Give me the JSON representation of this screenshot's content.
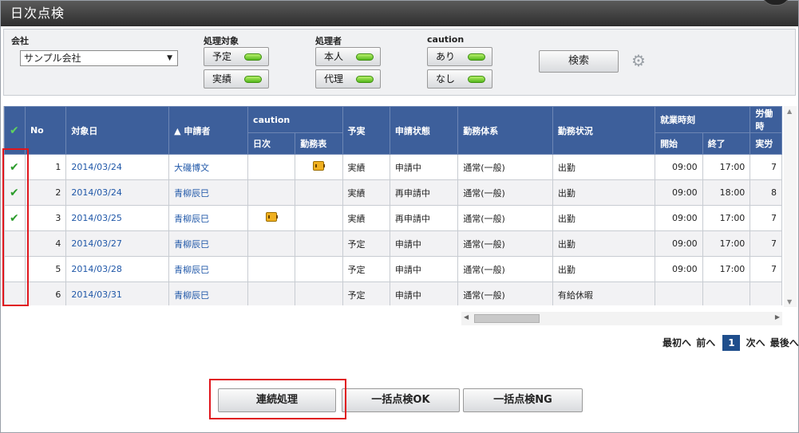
{
  "title": "日次点検",
  "filters": {
    "company_label": "会社",
    "company_value": "サンプル会社",
    "target_label": "処理対象",
    "target_buttons": [
      "予定",
      "実績"
    ],
    "processor_label": "処理者",
    "processor_buttons": [
      "本人",
      "代理"
    ],
    "caution_label": "caution",
    "caution_buttons": [
      "あり",
      "なし"
    ],
    "search_label": "検索"
  },
  "table": {
    "headers": {
      "no": "No",
      "date": "対象日",
      "applicant": "▲ 申請者",
      "caution": "caution",
      "caution_daily": "日次",
      "caution_sheet": "勤務表",
      "plan_actual": "予実",
      "status": "申請状態",
      "system": "勤務体系",
      "work_status": "勤務状況",
      "work_time": "就業時刻",
      "start": "開始",
      "end": "終了",
      "labor": "労働時",
      "labor_sub": "実労"
    },
    "rows": [
      {
        "check": "✔",
        "no": "1",
        "date": "2014/03/24",
        "applicant": "大磯博文",
        "daily": "",
        "sheet": "icon",
        "pa": "実績",
        "status": "申請中",
        "system": "通常(一般)",
        "work": "出勤",
        "start": "09:00",
        "end": "17:00",
        "labor": "7"
      },
      {
        "check": "✔",
        "no": "2",
        "date": "2014/03/24",
        "applicant": "青柳辰巳",
        "daily": "",
        "sheet": "",
        "pa": "実績",
        "status": "再申請中",
        "system": "通常(一般)",
        "work": "出勤",
        "start": "09:00",
        "end": "18:00",
        "labor": "8"
      },
      {
        "check": "✔",
        "no": "3",
        "date": "2014/03/25",
        "applicant": "青柳辰巳",
        "daily": "icon",
        "sheet": "",
        "pa": "実績",
        "status": "再申請中",
        "system": "通常(一般)",
        "work": "出勤",
        "start": "09:00",
        "end": "17:00",
        "labor": "7"
      },
      {
        "check": "",
        "no": "4",
        "date": "2014/03/27",
        "applicant": "青柳辰巳",
        "daily": "",
        "sheet": "",
        "pa": "予定",
        "status": "申請中",
        "system": "通常(一般)",
        "work": "出勤",
        "start": "09:00",
        "end": "17:00",
        "labor": "7"
      },
      {
        "check": "",
        "no": "5",
        "date": "2014/03/28",
        "applicant": "青柳辰巳",
        "daily": "",
        "sheet": "",
        "pa": "予定",
        "status": "申請中",
        "system": "通常(一般)",
        "work": "出勤",
        "start": "09:00",
        "end": "17:00",
        "labor": "7"
      },
      {
        "check": "",
        "no": "6",
        "date": "2014/03/31",
        "applicant": "青柳辰巳",
        "daily": "",
        "sheet": "",
        "pa": "予定",
        "status": "申請中",
        "system": "通常(一般)",
        "work": "有給休暇",
        "start": "",
        "end": "",
        "labor": ""
      }
    ]
  },
  "pager": {
    "first": "最初へ",
    "prev": "前へ",
    "current": "1",
    "next": "次へ",
    "last": "最後へ"
  },
  "actions": {
    "continuous": "連続処理",
    "bulk_ok": "一括点検OK",
    "bulk_ng": "一括点検NG"
  }
}
